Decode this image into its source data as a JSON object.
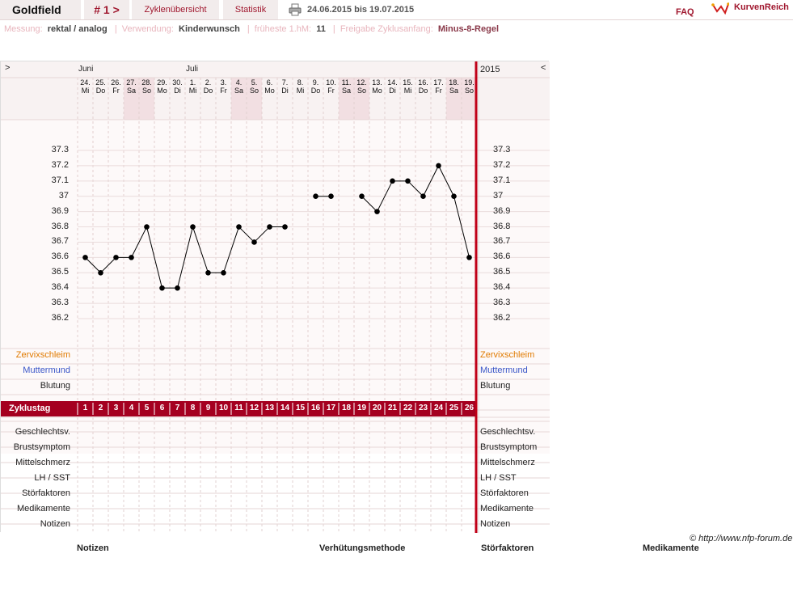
{
  "header": {
    "app_title": "Goldfield",
    "cycle_label": "# 1 >",
    "tabs": [
      "Zyklenübersicht",
      "Statistik"
    ],
    "date_range": "24.06.2015 bis 19.07.2015",
    "faq": "FAQ",
    "logo_text": "KurvenReich"
  },
  "settings": {
    "measurement_label": "Messung:",
    "measurement_value": "rektal / analog",
    "usage_label": "Verwendung:",
    "usage_value": "Kinderwunsch",
    "earliest_label": "früheste 1.hM:",
    "earliest_value": "11",
    "release_label": "Freigabe Zyklusanfang:",
    "release_value": "Minus-8-Regel"
  },
  "chart_nav": {
    "prev": ">",
    "next": "<",
    "year": "2015",
    "month1": "Juni",
    "month2": "Juli"
  },
  "colors": {
    "accent": "#a50020",
    "weekend": "#f2dfe2",
    "cervical": "#e07a00",
    "cervix": "#3a56c8"
  },
  "rows": {
    "zervixschleim": "Zervixschleim",
    "muttermund": "Muttermund",
    "blutung": "Blutung",
    "zyklustag": "Zyklustag",
    "lower": [
      "Geschlechtsv.",
      "Brustsymptom",
      "Mittelschmerz",
      "LH / SST",
      "Störfaktoren",
      "Medikamente",
      "Notizen"
    ]
  },
  "footer": {
    "notizen": "Notizen",
    "verhuetung": "Verhütungsmethode",
    "stoerfaktoren": "Störfaktoren",
    "medikamente": "Medikamente",
    "credit": "© http://www.nfp-forum.de"
  },
  "chart_data": {
    "type": "line",
    "x": [
      {
        "date": "24.",
        "day": "Mi",
        "weekend": false
      },
      {
        "date": "25.",
        "day": "Do",
        "weekend": false
      },
      {
        "date": "26.",
        "day": "Fr",
        "weekend": false
      },
      {
        "date": "27.",
        "day": "Sa",
        "weekend": true
      },
      {
        "date": "28.",
        "day": "So",
        "weekend": true
      },
      {
        "date": "29.",
        "day": "Mo",
        "weekend": false
      },
      {
        "date": "30.",
        "day": "Di",
        "weekend": false
      },
      {
        "date": "1.",
        "day": "Mi",
        "weekend": false
      },
      {
        "date": "2.",
        "day": "Do",
        "weekend": false
      },
      {
        "date": "3.",
        "day": "Fr",
        "weekend": false
      },
      {
        "date": "4.",
        "day": "Sa",
        "weekend": true
      },
      {
        "date": "5.",
        "day": "So",
        "weekend": true
      },
      {
        "date": "6.",
        "day": "Mo",
        "weekend": false
      },
      {
        "date": "7.",
        "day": "Di",
        "weekend": false
      },
      {
        "date": "8.",
        "day": "Mi",
        "weekend": false
      },
      {
        "date": "9.",
        "day": "Do",
        "weekend": false
      },
      {
        "date": "10.",
        "day": "Fr",
        "weekend": false
      },
      {
        "date": "11.",
        "day": "Sa",
        "weekend": true
      },
      {
        "date": "12.",
        "day": "So",
        "weekend": true
      },
      {
        "date": "13.",
        "day": "Mo",
        "weekend": false
      },
      {
        "date": "14.",
        "day": "Di",
        "weekend": false
      },
      {
        "date": "15.",
        "day": "Mi",
        "weekend": false
      },
      {
        "date": "16.",
        "day": "Do",
        "weekend": false
      },
      {
        "date": "17.",
        "day": "Fr",
        "weekend": false
      },
      {
        "date": "18.",
        "day": "Sa",
        "weekend": true
      },
      {
        "date": "19.",
        "day": "So",
        "weekend": true
      }
    ],
    "cycle_days": [
      1,
      2,
      3,
      4,
      5,
      6,
      7,
      8,
      9,
      10,
      11,
      12,
      13,
      14,
      15,
      16,
      17,
      18,
      19,
      20,
      21,
      22,
      23,
      24,
      25,
      26
    ],
    "values": [
      36.6,
      36.5,
      36.6,
      36.6,
      36.8,
      36.4,
      36.4,
      36.8,
      36.5,
      36.5,
      36.8,
      36.7,
      36.8,
      36.8,
      null,
      37.0,
      37.0,
      null,
      37.0,
      36.9,
      37.1,
      37.1,
      37.0,
      37.2,
      37.0,
      36.6
    ],
    "yticks": [
      "37.3",
      "37.2",
      "37.1",
      "37",
      "36.9",
      "36.8",
      "36.7",
      "36.6",
      "36.5",
      "36.4",
      "36.3",
      "36.2"
    ],
    "ylim": [
      36.2,
      37.3
    ],
    "grid": true
  }
}
